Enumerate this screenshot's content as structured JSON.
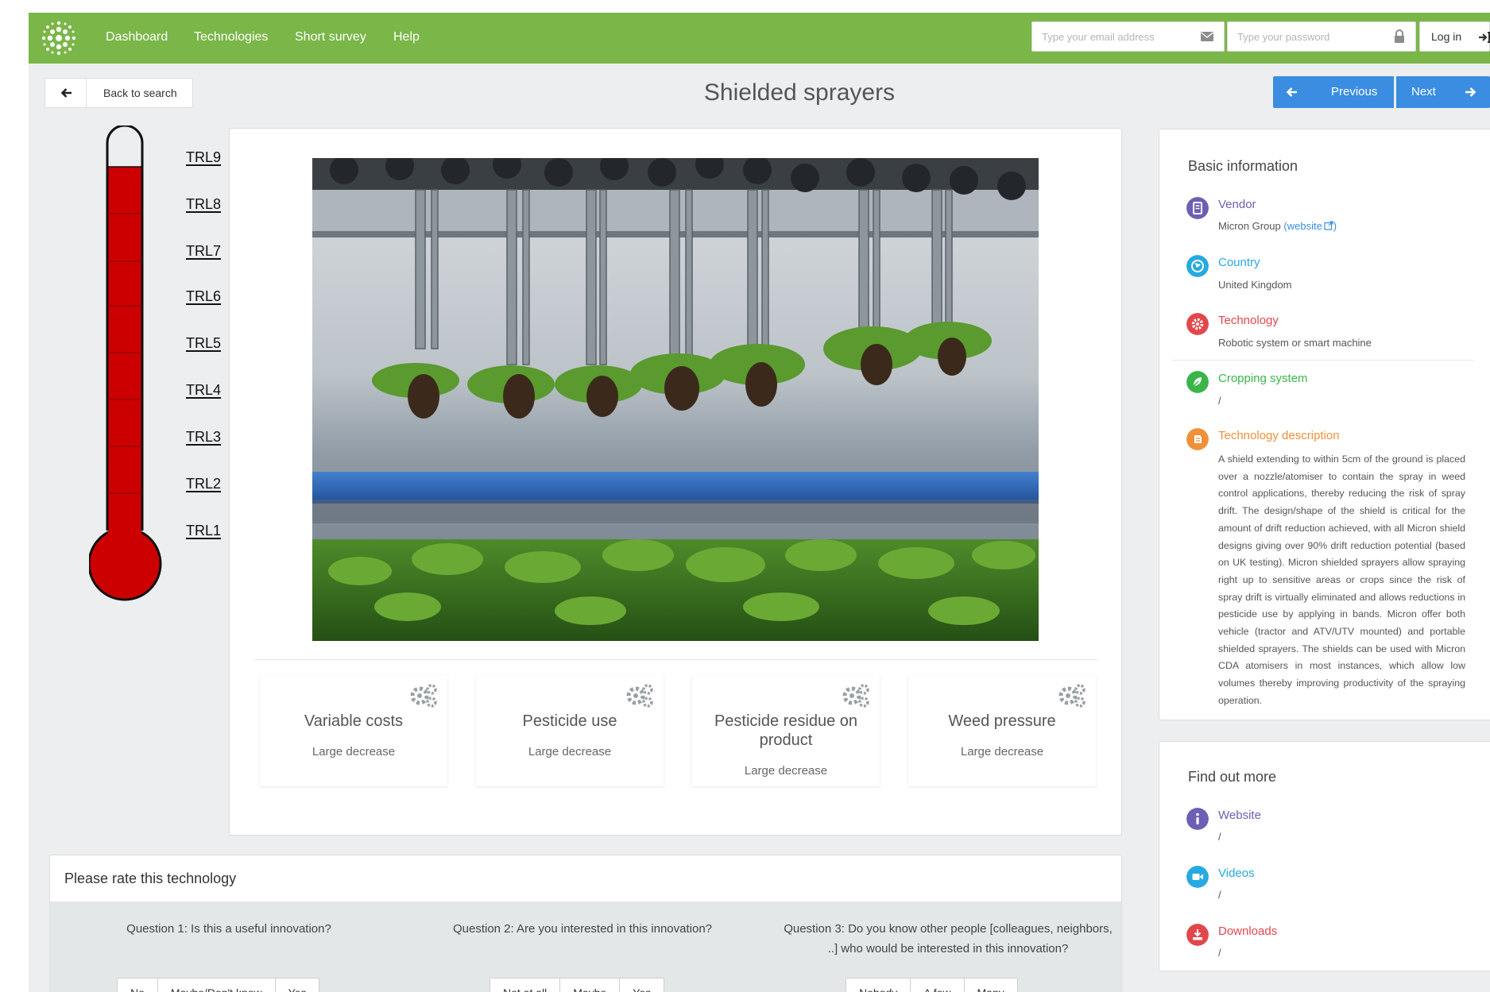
{
  "navbar": {
    "links": [
      "Dashboard",
      "Technologies",
      "Short survey",
      "Help"
    ],
    "email_placeholder": "Type your email address",
    "password_placeholder": "Type your password",
    "login_label": "Log in",
    "brand_color": "#7ab648"
  },
  "subheader": {
    "back_label": "Back to search",
    "title": "Shielded sprayers",
    "previous_label": "Previous",
    "next_label": "Next",
    "accent_color": "#3a8de0"
  },
  "trl": {
    "levels": [
      "TRL9",
      "TRL8",
      "TRL7",
      "TRL6",
      "TRL5",
      "TRL4",
      "TRL3",
      "TRL2",
      "TRL1"
    ],
    "current_level": 8
  },
  "impacts": [
    {
      "title": "Variable costs",
      "value": "Large decrease"
    },
    {
      "title": "Pesticide use",
      "value": "Large decrease"
    },
    {
      "title": "Pesticide residue on product",
      "value": "Large decrease"
    },
    {
      "title": "Weed pressure",
      "value": "Large decrease"
    }
  ],
  "rating": {
    "title": "Please rate this technology",
    "questions": [
      {
        "text": "Question 1: Is this a useful innovation?",
        "options": [
          "No",
          "Maybe/Don't know",
          "Yes"
        ]
      },
      {
        "text": "Question 2: Are you interested in this innovation?",
        "options": [
          "Not at all",
          "Maybe",
          "Yes"
        ]
      },
      {
        "text": "Question 3: Do you know other people [colleagues, neighbors, ..] who would be interested in this innovation?",
        "options": [
          "Nobody",
          "A few",
          "Many"
        ]
      }
    ]
  },
  "basic_info": {
    "title": "Basic information",
    "vendor": {
      "label": "Vendor",
      "value": "Micron Group",
      "link": "website",
      "icon": "vendor-icon",
      "color": "#6d5fb3"
    },
    "country": {
      "label": "Country",
      "value": "United Kingdom",
      "icon": "globe-icon",
      "color": "#27a9e1"
    },
    "technology": {
      "label": "Technology",
      "value": "Robotic system or smart machine",
      "icon": "gear-icon",
      "color": "#e2474b"
    },
    "cropping": {
      "label": "Cropping system",
      "value": "/",
      "icon": "leaf-icon",
      "color": "#3bb54a"
    },
    "description": {
      "label": "Technology description",
      "icon": "document-icon",
      "color": "#f0913a",
      "text": "A shield extending to within 5cm of the ground is placed over a nozzle/atomiser to contain the spray in weed control applications, thereby reducing the risk of spray drift. The design/shape of the shield is critical for the amount of drift reduction achieved, with all Micron shield designs giving over 90% drift reduction potential (based on UK testing). Micron shielded sprayers allow spraying right up to sensitive areas or crops since the risk of spray drift is virtually eliminated and allows reductions in pesticide use by applying in bands. Micron offer both vehicle (tractor and ATV/UTV mounted) and portable shielded sprayers. The shields can be used with Micron CDA atomisers in most instances, which allow low volumes thereby improving productivity of the spraying operation."
    }
  },
  "find_more": {
    "title": "Find out more",
    "website": {
      "label": "Website",
      "value": "/",
      "icon": "info-icon",
      "color": "#6d5fb3"
    },
    "videos": {
      "label": "Videos",
      "value": "/",
      "icon": "video-icon",
      "color": "#27a9e1"
    },
    "downloads": {
      "label": "Downloads",
      "value": "/",
      "icon": "download-icon",
      "color": "#e2474b"
    }
  }
}
